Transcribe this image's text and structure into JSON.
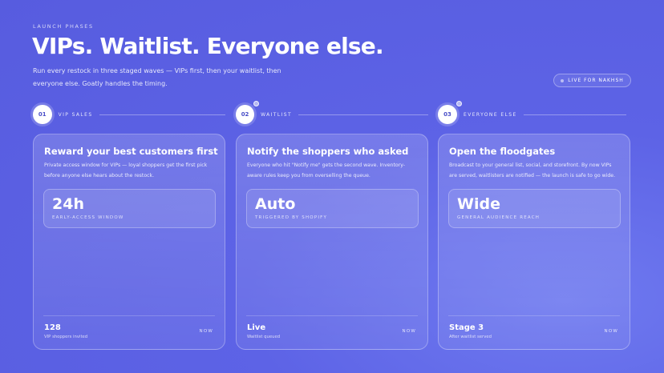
{
  "header": {
    "eyebrow": "LAUNCH PHASES",
    "title": "VIPs. Waitlist. Everyone else.",
    "subtitle": "Run every restock in three staged waves — VIPs first, then your waitlist, then everyone else. Goatly handles the timing.",
    "live_badge": "LIVE FOR NAKHSH"
  },
  "phases": [
    {
      "number": "01",
      "label": "VIP SALES"
    },
    {
      "number": "02",
      "label": "WAITLIST"
    },
    {
      "number": "03",
      "label": "EVERYONE ELSE"
    }
  ],
  "cards": [
    {
      "title": "Reward your best customers first",
      "description": "Private access window for VIPs — loyal shoppers get the first pick before anyone else hears about the restock.",
      "stat_value": "24h",
      "stat_label": "EARLY-ACCESS WINDOW",
      "foot_value": "128",
      "foot_label": "VIP shoppers invited",
      "foot_status": "NOW"
    },
    {
      "title": "Notify the shoppers who asked",
      "description": "Everyone who hit \"Notify me\" gets the second wave. Inventory-aware rules keep you from overselling the queue.",
      "stat_value": "Auto",
      "stat_label": "TRIGGERED BY SHOPIFY",
      "foot_value": "Live",
      "foot_label": "Waitlist queued",
      "foot_status": "NOW"
    },
    {
      "title": "Open the floodgates",
      "description": "Broadcast to your general list, social, and storefront. By now VIPs are served, waitlisters are notified — the launch is safe to go wide.",
      "stat_value": "Wide",
      "stat_label": "GENERAL AUDIENCE REACH",
      "foot_value": "Stage 3",
      "foot_label": "After waitlist served",
      "foot_status": "NOW"
    }
  ]
}
